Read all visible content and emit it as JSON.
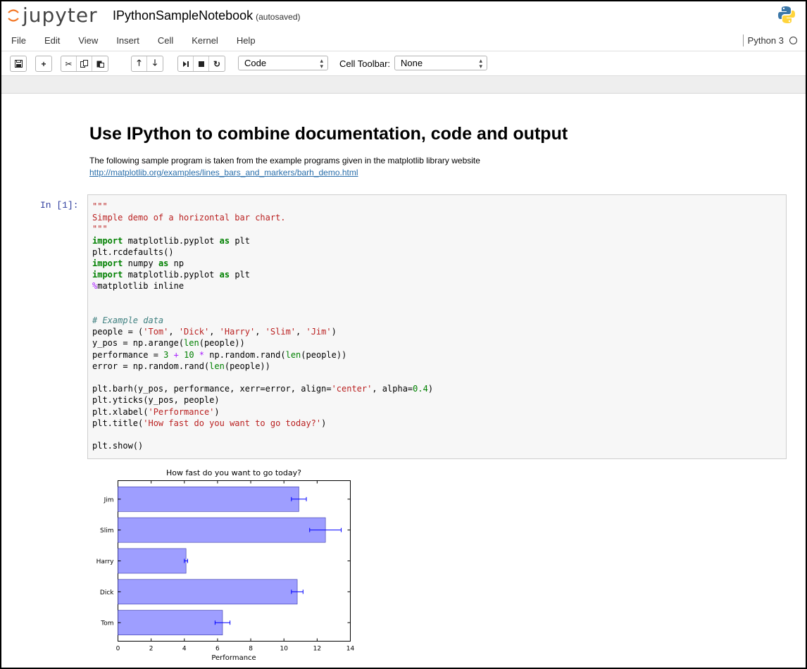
{
  "header": {
    "logo_text": "jupyter",
    "notebook_name": "IPythonSampleNotebook",
    "autosave": "(autosaved)"
  },
  "menubar": {
    "items": [
      "File",
      "Edit",
      "View",
      "Insert",
      "Cell",
      "Kernel",
      "Help"
    ],
    "kernel_name": "Python 3"
  },
  "toolbar": {
    "cell_type": "Code",
    "cell_toolbar_label": "Cell Toolbar:",
    "cell_toolbar_value": "None"
  },
  "markdown": {
    "heading": "Use IPython to combine documentation, code and output",
    "paragraph": "The following sample program is taken from the example programs given in the matplotlib library website",
    "link": "http://matplotlib.org/examples/lines_bars_and_markers/barh_demo.html"
  },
  "code_cell": {
    "prompt": "In [1]:",
    "lines": [
      "\"\"\"",
      "Simple demo of a horizontal bar chart.",
      "\"\"\"",
      "import matplotlib.pyplot as plt",
      "plt.rcdefaults()",
      "import numpy as np",
      "import matplotlib.pyplot as plt",
      "%matplotlib inline",
      "",
      "",
      "# Example data",
      "people = ('Tom', 'Dick', 'Harry', 'Slim', 'Jim')",
      "y_pos = np.arange(len(people))",
      "performance = 3 + 10 * np.random.rand(len(people))",
      "error = np.random.rand(len(people))",
      "",
      "plt.barh(y_pos, performance, xerr=error, align='center', alpha=0.4)",
      "plt.yticks(y_pos, people)",
      "plt.xlabel('Performance')",
      "plt.title('How fast do you want to go today?')",
      "",
      "plt.show()"
    ]
  },
  "colors": {
    "bar_fill": "#9999ff",
    "bar_edge": "#3333aa",
    "error_bar": "#0000ff"
  },
  "chart_data": {
    "type": "bar",
    "orientation": "horizontal",
    "title": "How fast do you want to go today?",
    "xlabel": "Performance",
    "ylabel": "",
    "categories": [
      "Tom",
      "Dick",
      "Harry",
      "Slim",
      "Jim"
    ],
    "values": [
      6.3,
      10.8,
      4.1,
      12.5,
      10.9
    ],
    "errors": [
      0.45,
      0.35,
      0.1,
      0.95,
      0.45
    ],
    "xlim": [
      0,
      14
    ],
    "xticks": [
      0,
      2,
      4,
      6,
      8,
      10,
      12,
      14
    ],
    "grid": false,
    "legend": "none"
  }
}
